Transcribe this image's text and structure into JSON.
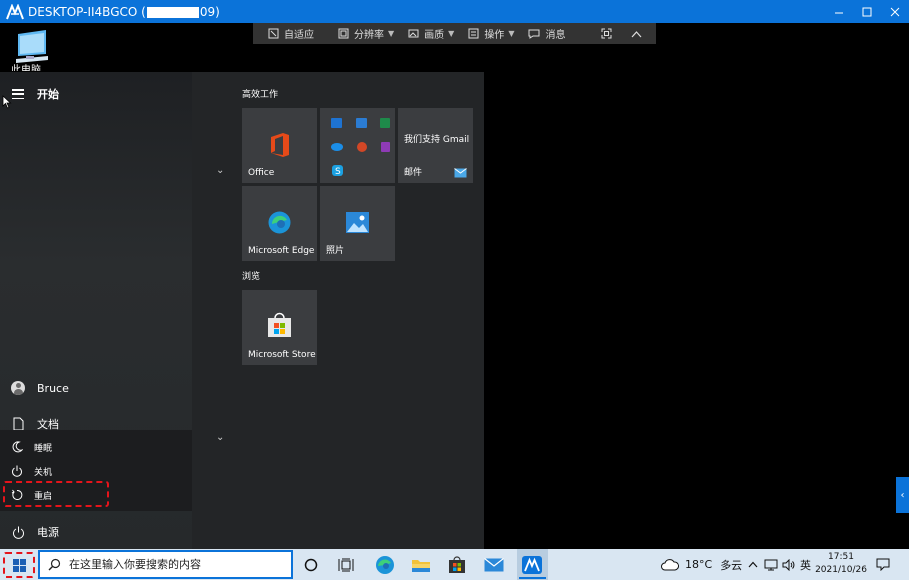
{
  "window": {
    "title_prefix": "DESKTOP-II4BGCO (",
    "title_suffix": "09)"
  },
  "remote_toolbar": {
    "items": [
      {
        "label": "自适应",
        "icon": "fit-screen-icon"
      },
      {
        "label": "分辨率",
        "icon": "resolution-icon",
        "dropdown": true
      },
      {
        "label": "画质",
        "icon": "image-quality-icon",
        "dropdown": true
      },
      {
        "label": "操作",
        "icon": "operation-icon",
        "dropdown": true
      },
      {
        "label": "消息",
        "icon": "message-icon"
      }
    ]
  },
  "desktop": {
    "icon_label": "此电脑"
  },
  "start_menu": {
    "header": "开始",
    "user": "Bruce",
    "documents": "文档",
    "power_label": "电源",
    "power_options": [
      "睡眠",
      "关机",
      "重启"
    ],
    "groups": [
      {
        "title": "高效工作",
        "tiles": [
          {
            "label": "Office",
            "icon": "office-icon"
          },
          {
            "label": "",
            "icon": "office-apps-folder-icon"
          },
          {
            "label": "我们支持 Gmail",
            "sublabel": "邮件",
            "icon": "mail-icon"
          },
          {
            "label": "Microsoft Edge",
            "icon": "edge-icon"
          },
          {
            "label": "照片",
            "icon": "photos-icon"
          }
        ]
      },
      {
        "title": "浏览",
        "tiles": [
          {
            "label": "Microsoft Store",
            "icon": "store-icon"
          }
        ]
      }
    ]
  },
  "taskbar": {
    "search_placeholder": "在这里输入你要搜索的内容",
    "weather_temp": "18°C",
    "weather_desc": "多云",
    "ime": "英",
    "time": "17:51",
    "date": "2021/10/26"
  },
  "colors": {
    "titlebar": "#0b73d9",
    "highlight_dashed": "#e5141b",
    "taskbar": "#d9e6f2"
  }
}
